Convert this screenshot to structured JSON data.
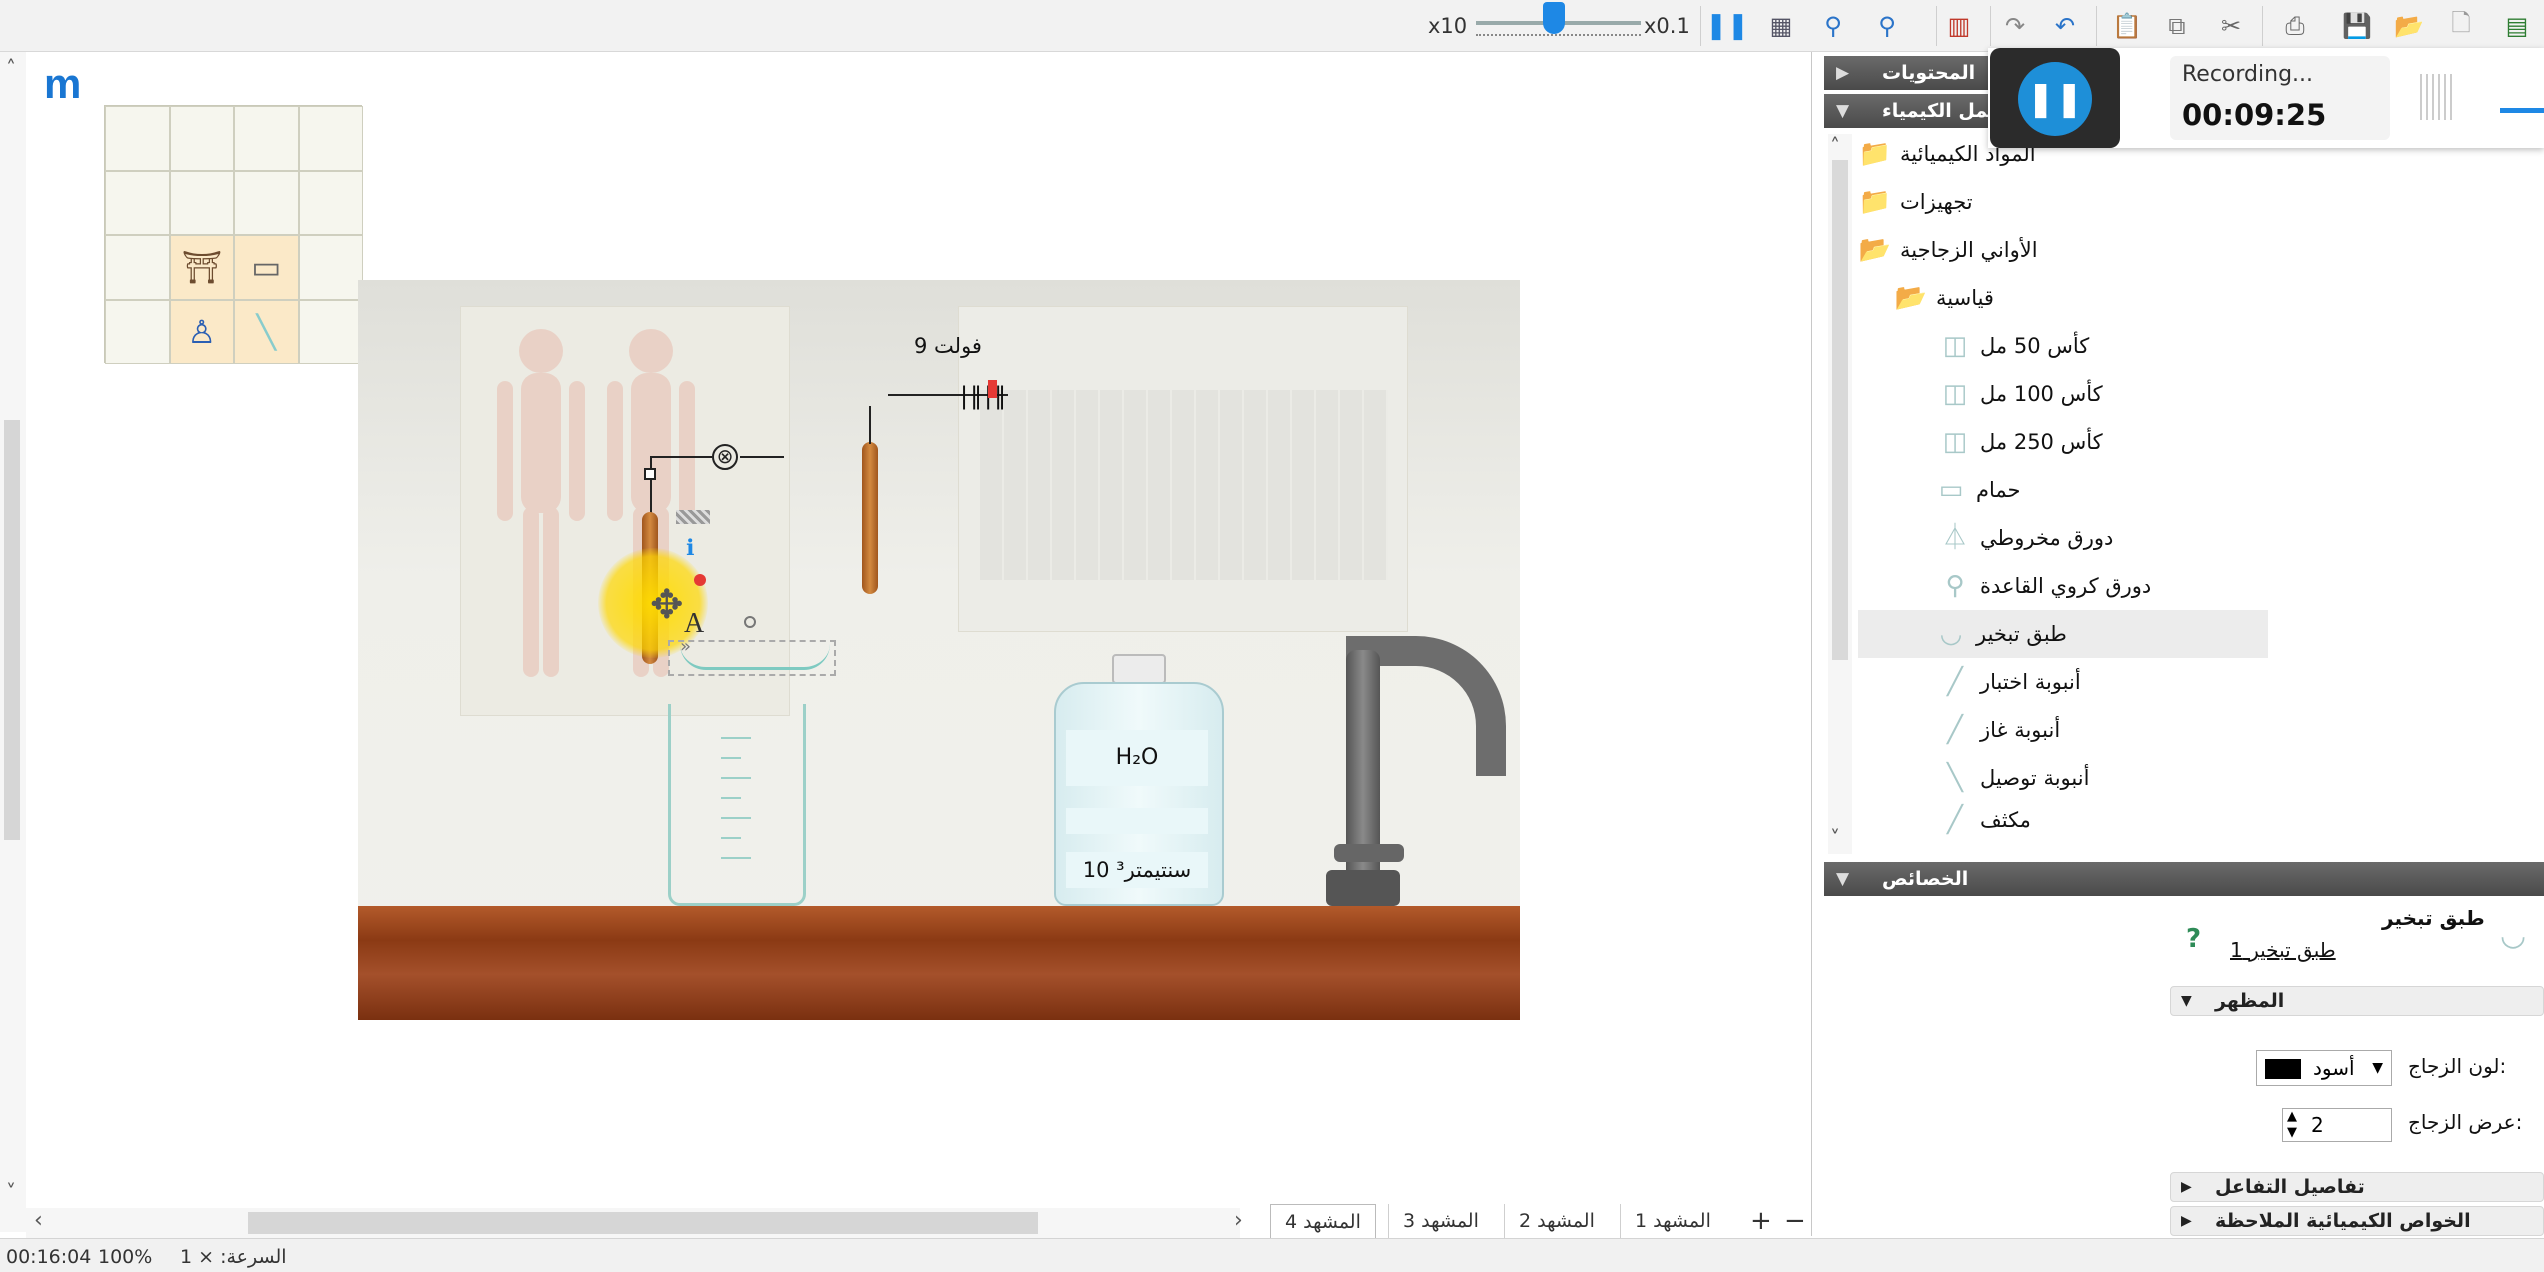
{
  "toolbar": {
    "speed_max_label": "x10",
    "speed_min_label": "x0.1"
  },
  "canvas": {
    "logo_letter": "m"
  },
  "scene": {
    "battery_label": "9 فولت",
    "bottle_formula": "H₂O",
    "bottle_volume": "10 سنتيمتر³"
  },
  "scene_tabs": [
    "المشهد 4",
    "المشهد 3",
    "المشهد 2",
    "المشهد 1"
  ],
  "tab_add": "+",
  "tab_remove": "−",
  "status": {
    "time": "00:16:04",
    "zoom": "100%",
    "speed": "السرعة: × 1"
  },
  "panel": {
    "contents_title": "المحتويات",
    "lab_title": "معمل الكيمياء",
    "properties_title": "الخصائص",
    "tree": [
      {
        "label": "المواد الكيميائية",
        "icon": "folder-icon"
      },
      {
        "label": "تجهيزات",
        "icon": "folder-icon"
      },
      {
        "label": "الأواني الزجاجية",
        "icon": "folder-icon"
      },
      {
        "label": "قياسية",
        "icon": "folder-icon"
      },
      {
        "label": "كأس 50 مل",
        "icon": "beaker-icon"
      },
      {
        "label": "كأس 100 مل",
        "icon": "beaker-icon"
      },
      {
        "label": "كأس 250 مل",
        "icon": "beaker-icon"
      },
      {
        "label": "حمام",
        "icon": "bath-icon"
      },
      {
        "label": "دورق مخروطي",
        "icon": "conical-flask-icon"
      },
      {
        "label": "دورق كروي القاعدة",
        "icon": "round-flask-icon"
      },
      {
        "label": "طبق تبخير",
        "icon": "evaporating-dish-icon"
      },
      {
        "label": "أنبوبة اختبار",
        "icon": "test-tube-icon"
      },
      {
        "label": "أنبوبة غاز",
        "icon": "gas-tube-icon"
      },
      {
        "label": "أنبوبة توصيل",
        "icon": "delivery-tube-icon"
      },
      {
        "label": "مكثف",
        "icon": "condenser-icon"
      }
    ],
    "selected_index": 10,
    "props": {
      "object_name": "طبق تبخير",
      "object_link": "طبق تبخير 1",
      "help": "?",
      "appearance_title": "المظهر",
      "glass_color_label": "لون الزجاج:",
      "glass_color_value": "أسود",
      "glass_width_label": "عرض الزجاج:",
      "glass_width_value": "2",
      "reaction_details": "تفاصيل التفاعل",
      "chemical_properties": "الخواص الكيميائية الملاحظة"
    }
  },
  "recording": {
    "status": "Recording...",
    "elapsed": "00:09:25"
  },
  "colors": {
    "accent": "#1e88e5",
    "panel_header": "#555555",
    "bench": "#9b4a22"
  }
}
